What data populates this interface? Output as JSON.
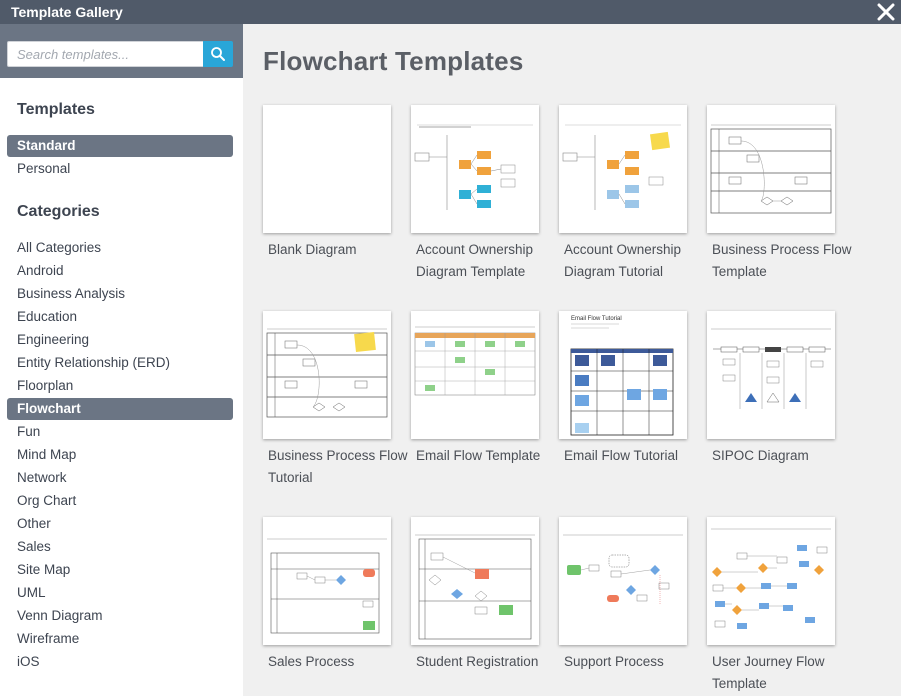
{
  "window": {
    "title": "Template Gallery"
  },
  "search": {
    "placeholder": "Search templates..."
  },
  "sidebar": {
    "templates_heading": "Templates",
    "template_items": [
      {
        "label": "Standard",
        "active": true
      },
      {
        "label": "Personal",
        "active": false
      }
    ],
    "categories_heading": "Categories",
    "category_items": [
      {
        "label": "All Categories",
        "active": false
      },
      {
        "label": "Android",
        "active": false
      },
      {
        "label": "Business Analysis",
        "active": false
      },
      {
        "label": "Education",
        "active": false
      },
      {
        "label": "Engineering",
        "active": false
      },
      {
        "label": "Entity Relationship (ERD)",
        "active": false
      },
      {
        "label": "Floorplan",
        "active": false
      },
      {
        "label": "Flowchart",
        "active": true
      },
      {
        "label": "Fun",
        "active": false
      },
      {
        "label": "Mind Map",
        "active": false
      },
      {
        "label": "Network",
        "active": false
      },
      {
        "label": "Org Chart",
        "active": false
      },
      {
        "label": "Other",
        "active": false
      },
      {
        "label": "Sales",
        "active": false
      },
      {
        "label": "Site Map",
        "active": false
      },
      {
        "label": "UML",
        "active": false
      },
      {
        "label": "Venn Diagram",
        "active": false
      },
      {
        "label": "Wireframe",
        "active": false
      },
      {
        "label": "iOS",
        "active": false
      }
    ]
  },
  "main": {
    "title": "Flowchart Templates",
    "templates": [
      {
        "label": "Blank Diagram",
        "thumb": "blank"
      },
      {
        "label": "Account Ownership Diagram Template",
        "thumb": "account"
      },
      {
        "label": "Account Ownership Diagram Tutorial",
        "thumb": "account-tutorial"
      },
      {
        "label": "Business Process Flow Template",
        "thumb": "swimlane"
      },
      {
        "label": "Business Process Flow Tutorial",
        "thumb": "swimlane-tutorial"
      },
      {
        "label": "Email Flow Template",
        "thumb": "email"
      },
      {
        "label": "Email Flow Tutorial",
        "thumb": "email-tutorial",
        "thumb_title": "Email Flow Tutorial"
      },
      {
        "label": "SIPOC Diagram",
        "thumb": "sipoc"
      },
      {
        "label": "Sales Process",
        "thumb": "sales"
      },
      {
        "label": "Student Registration",
        "thumb": "student"
      },
      {
        "label": "Support Process",
        "thumb": "support"
      },
      {
        "label": "User Journey Flow Template",
        "thumb": "journey"
      }
    ]
  },
  "colors": {
    "titlebar": "#505a69",
    "search_bar_bg": "#6b7584",
    "search_button": "#29a6d8",
    "active_item": "#6b7584",
    "main_bg": "#f0f0f0",
    "text": "#3d4450"
  },
  "icons": {
    "close": "close-icon",
    "search": "search-icon"
  }
}
